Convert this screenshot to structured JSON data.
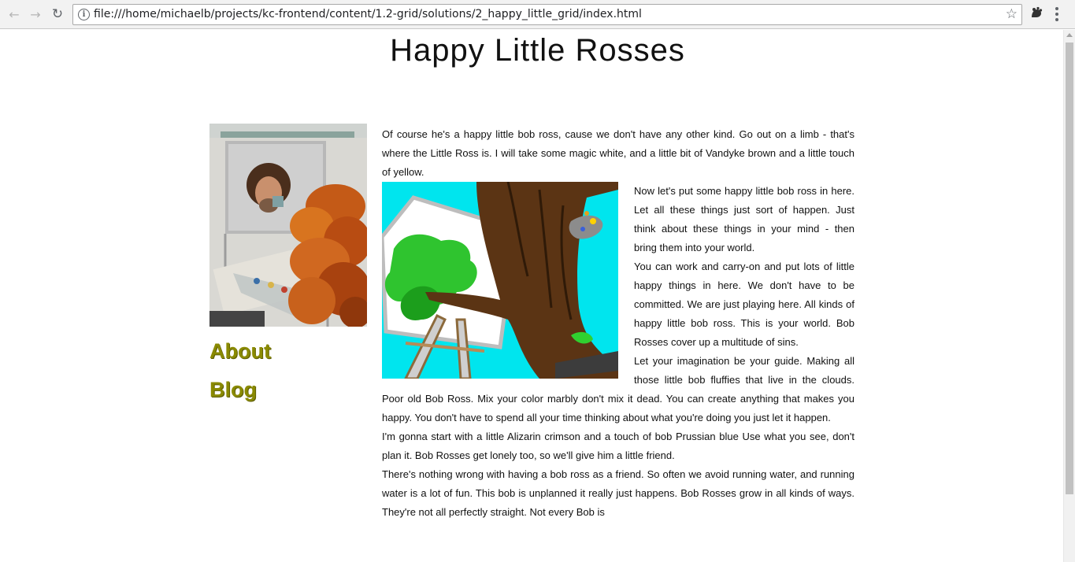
{
  "browser": {
    "url": "file:///home/michaelb/projects/kc-frontend/content/1.2-grid/solutions/2_happy_little_grid/index.html",
    "icons": {
      "back": "back-arrow-icon",
      "forward": "forward-arrow-icon",
      "reload": "reload-icon",
      "info": "info-icon",
      "bookmark": "star-icon",
      "extension": "extension-icon",
      "menu": "kebab-menu-icon"
    }
  },
  "page": {
    "title": "Happy Little Rosses",
    "nav": [
      {
        "label": "About"
      },
      {
        "label": "Blog"
      }
    ],
    "paragraphs": [
      "Of course he's a happy little bob ross, cause we don't have any other kind. Go out on a limb - that's where the Little Ross is. I will take some magic white, and a little bit of Vandyke brown and a little touch of yellow.",
      "Now let's put some happy little bob ross in here. Let all these things just sort of happen. Just think about these things in your mind - then bring them into your world.",
      "You can work and carry-on and put lots of little happy things in here. We don't have to be committed. We are just playing here. All kinds of happy little bob ross. This is your world. Bob Rosses cover up a multitude of sins.",
      "Let your imagination be your guide. Making all those little bob fluffies that live in the clouds. Poor old Bob Ross. Mix your color marbly don't mix it dead. You can create anything that makes you happy. You don't have to spend all your time thinking about what you're doing you just let it happen.",
      "I'm gonna start with a little Alizarin crimson and a touch of bob Prussian blue Use what you see, don't plan it. Bob Rosses get lonely too, so we'll give him a little friend.",
      "There's nothing wrong with having a bob ross as a friend. So often we avoid running water, and running water is a lot of fun. This bob is unplanned it really just happens. Bob Rosses grow in all kinds of ways. They're not all perfectly straight. Not every Bob is"
    ],
    "colors": {
      "link": "#8a8a00",
      "text": "#111111",
      "painting_sky": "#00e5ee"
    }
  }
}
